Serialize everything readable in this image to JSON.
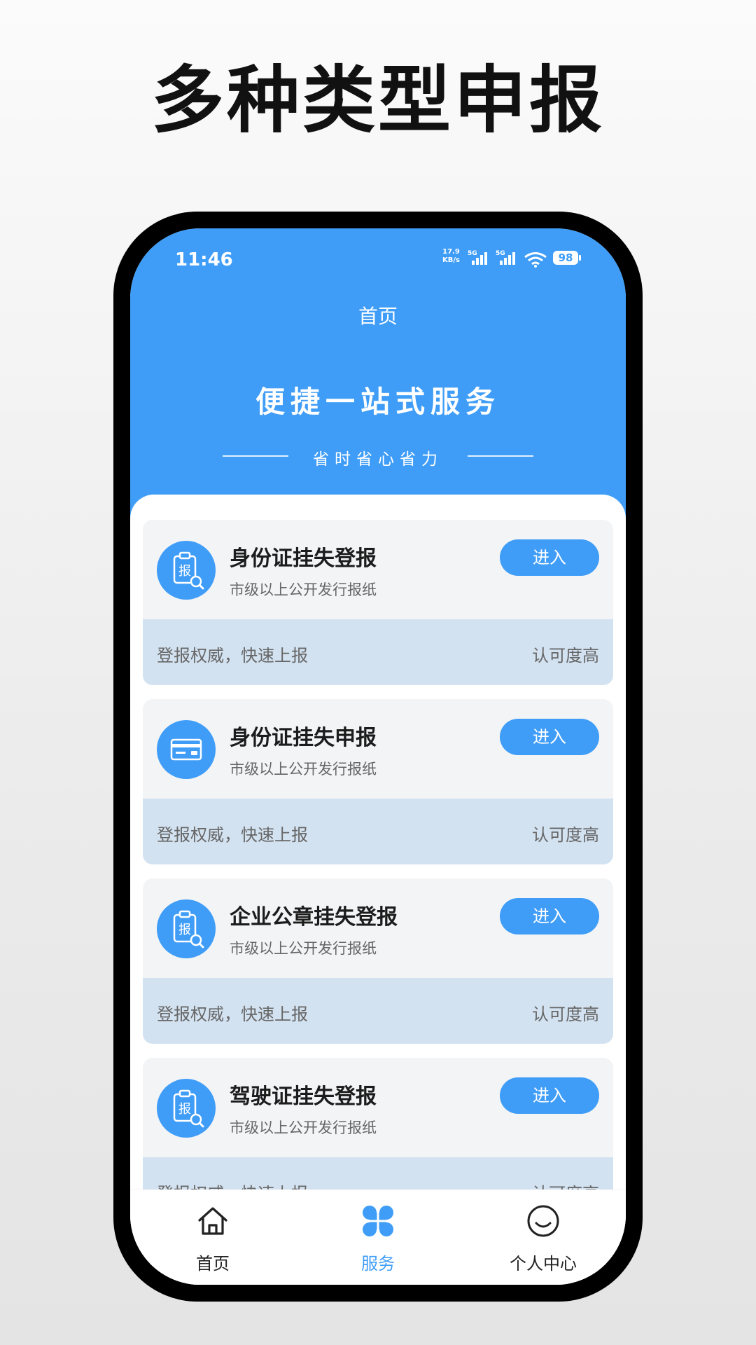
{
  "headline": "多种类型申报",
  "status_bar": {
    "time": "11:46",
    "net_speed_value": "17.9",
    "net_speed_unit": "KB/s",
    "sim1": "5G",
    "sim2": "5G",
    "battery": "98"
  },
  "nav": {
    "title": "首页"
  },
  "hero": {
    "title": "便捷一站式服务",
    "subtitle": "省时省心省力"
  },
  "cards": [
    {
      "title": "身份证挂失登报",
      "subtitle": "市级以上公开发行报纸",
      "button": "进入",
      "footer_left": "登报权威，快速上报",
      "footer_right": "认可度高",
      "icon": "clipboard-report-icon",
      "icon_text": "报"
    },
    {
      "title": "身份证挂失申报",
      "subtitle": "市级以上公开发行报纸",
      "button": "进入",
      "footer_left": "登报权威，快速上报",
      "footer_right": "认可度高",
      "icon": "id-card-icon"
    },
    {
      "title": "企业公章挂失登报",
      "subtitle": "市级以上公开发行报纸",
      "button": "进入",
      "footer_left": "登报权威，快速上报",
      "footer_right": "认可度高",
      "icon": "clipboard-report-icon",
      "icon_text": "报"
    },
    {
      "title": "驾驶证挂失登报",
      "subtitle": "市级以上公开发行报纸",
      "button": "进入",
      "footer_left": "登报权威，快速上报",
      "footer_right": "认可度高",
      "icon": "clipboard-report-icon",
      "icon_text": "报"
    }
  ],
  "tabbar": {
    "items": [
      {
        "label": "首页",
        "icon": "home-icon",
        "active": false
      },
      {
        "label": "服务",
        "icon": "grid-clover-icon",
        "active": true
      },
      {
        "label": "个人中心",
        "icon": "smile-face-icon",
        "active": false
      }
    ]
  },
  "colors": {
    "primary": "#3f9df7",
    "card_footer": "#d3e2f1",
    "card_bg": "#f3f4f6"
  }
}
